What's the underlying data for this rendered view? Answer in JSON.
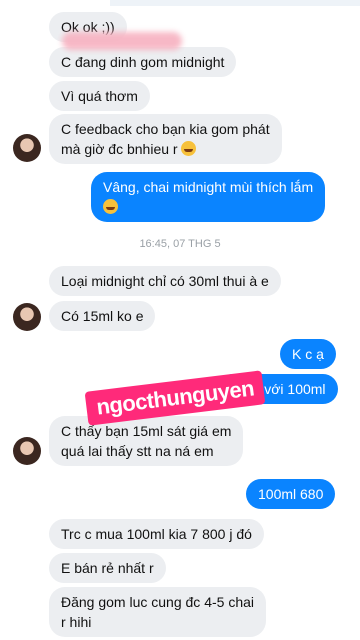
{
  "messages": {
    "m1": "Ok ok ;))",
    "m2": "C đang dinh gom midnight",
    "m3": "Vì quá thơm",
    "m4": "C feedback cho bạn kia gom phát\nmà giờ  đc bnhieu r",
    "m5": "Vâng, chai midnight mùi thích lắm",
    "time": "16:45, 07 THG 5",
    "m6": "Loại midnight chỉ có 30ml thui à e",
    "m7": "Có 15ml ko e",
    "m8": "K c ạ",
    "m9": "30ml với 100ml",
    "m10": "C thấy bạn 15ml  sát giá em\nquá lai thấy stt na ná em",
    "m11": "100ml 680",
    "m12": "Trc c mua 100ml kia 7 800 j đó",
    "m13": "E bán rẻ nhất r",
    "m14": "Đăng gom luc cung đc 4-5 chai\nr hihi"
  },
  "watermark": "ngocthunguyen",
  "colors": {
    "incoming": "#eceef1",
    "outgoing": "#0a84ff",
    "watermark": "#ff2a7a"
  }
}
